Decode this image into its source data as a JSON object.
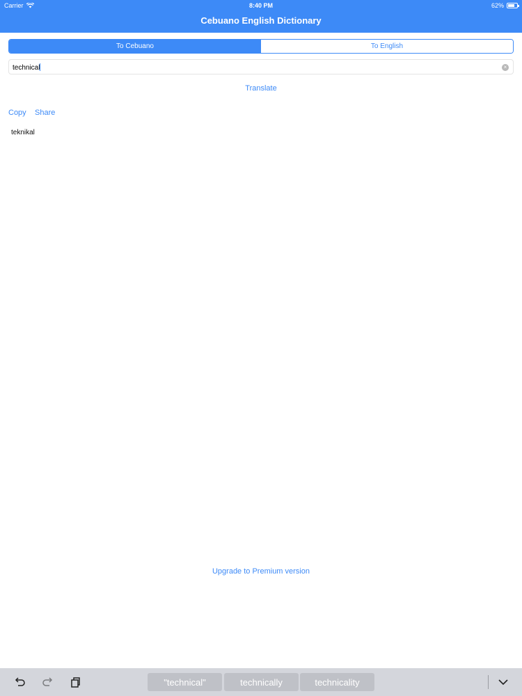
{
  "status_bar": {
    "carrier": "Carrier",
    "time": "8:40 PM",
    "battery": "62%",
    "icons": [
      "wifi-icon",
      "battery-icon"
    ]
  },
  "app": {
    "title": "Cebuano English Dictionary",
    "accent_color": "#3d8af7"
  },
  "segmented": {
    "options": [
      "To Cebuano",
      "To English"
    ],
    "selected": "To Cebuano"
  },
  "search": {
    "value": "technical",
    "clear_icon": "clear-icon"
  },
  "actions": {
    "translate": "Translate",
    "copy": "Copy",
    "share": "Share"
  },
  "result": {
    "text": "teknikal"
  },
  "upgrade": "Upgrade to Premium version",
  "keyboard": {
    "suggestions": [
      "\"technical\"",
      "technically",
      "technicality"
    ],
    "icons": [
      "undo-icon",
      "redo-icon",
      "paste-icon",
      "dismiss-keyboard-icon"
    ]
  }
}
